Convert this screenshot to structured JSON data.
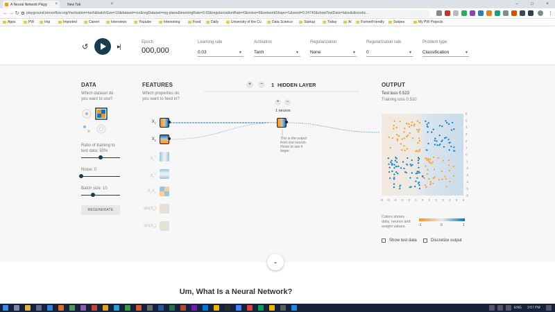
{
  "browser": {
    "tabs": [
      {
        "title": "A Neural Network Playg",
        "active": true
      },
      {
        "title": "New Tab",
        "active": false
      }
    ],
    "url": "playground.tensorflow.org/#activation=tanh&batchSize=10&dataset=xor&regDataset=reg-plane&learningRate=0.03&regularizationRate=0&noise=0&networkShape=1&seed=0.24742&showTestData=false&discretiz...",
    "bookmarks": [
      "Apps",
      "PW",
      "Imp",
      "Imported",
      "Career",
      "Interviews",
      "Youtube",
      "Interesting",
      "Food",
      "Daily",
      "University of the Cu",
      "Data Science",
      "Startup",
      "Today",
      "AI",
      "FarmerFriendly",
      "Swipes",
      "My PW Projects"
    ]
  },
  "controls": {
    "epoch_label": "Epoch",
    "epoch_value": "000,000",
    "learning_rate_label": "Learning rate",
    "learning_rate_value": "0.03",
    "activation_label": "Activation",
    "activation_value": "Tanh",
    "regularization_label": "Regularization",
    "regularization_value": "None",
    "reg_rate_label": "Regularization rate",
    "reg_rate_value": "0",
    "problem_type_label": "Problem type",
    "problem_type_value": "Classification"
  },
  "data_panel": {
    "title": "DATA",
    "question": [
      "Which dataset do",
      "you want to use?"
    ],
    "ratio_label": [
      "Ratio of training to",
      "test data:  50%"
    ],
    "ratio_fraction": 0.5,
    "noise_label": "Noise:  0",
    "noise_fraction": 0.0,
    "batch_label": "Batch size:  10",
    "batch_fraction": 0.3,
    "regenerate": "REGENERATE"
  },
  "features_panel": {
    "title": "FEATURES",
    "question": [
      "Which properties do",
      "you want to feed in?"
    ],
    "features": [
      {
        "base": "X",
        "sub": "1",
        "sup": "",
        "active": true
      },
      {
        "base": "X",
        "sub": "2",
        "sup": "",
        "active": true
      },
      {
        "base": "X",
        "sub": "1",
        "sup": "2",
        "active": false
      },
      {
        "base": "X",
        "sub": "2",
        "sup": "2",
        "active": false
      },
      {
        "base": "X",
        "sub": "1",
        "sup": "",
        "base2": "X",
        "sub2": "2",
        "active": false
      },
      {
        "base": "sin(X",
        "sub": "1",
        "suffix": ")",
        "active": false
      },
      {
        "base": "sin(X",
        "sub": "2",
        "suffix": ")",
        "active": false
      }
    ]
  },
  "hidden": {
    "count": "1",
    "title": "HIDDEN LAYER",
    "plus": "+",
    "minus": "−",
    "neuron_label": "1 neuron",
    "tooltip": [
      "This is the output",
      "from one neuron.",
      "Hover to see it",
      "larger."
    ]
  },
  "output": {
    "title": "OUTPUT",
    "test_loss": "Test loss 0.523",
    "training_loss": "Training loss 0.510",
    "x_ticks": [
      "-6",
      "-5",
      "-4",
      "-3",
      "-2",
      "-1",
      "0",
      "1",
      "2",
      "3",
      "4",
      "5",
      "6"
    ],
    "y_ticks": [
      "6",
      "5",
      "4",
      "3",
      "2",
      "1",
      "0",
      "-1",
      "-2",
      "-3",
      "-4",
      "-5",
      "-6"
    ],
    "legend_text": [
      "Colors shows",
      "data, neuron and",
      "weight values."
    ],
    "legend_ticks": [
      "-1",
      "0",
      "1"
    ],
    "show_test_data": "Show test data",
    "discretize_output": "Discretize output"
  },
  "colors": {
    "orange": "#f59322",
    "blue": "#0877bd",
    "navy": "#183d4e"
  },
  "lower": {
    "heading": "Um, What Is a Neural Network?",
    "scroll_icon": "chevron-down-icon"
  },
  "taskbar": {
    "lang": "ENG",
    "time": "3:57 PM"
  }
}
